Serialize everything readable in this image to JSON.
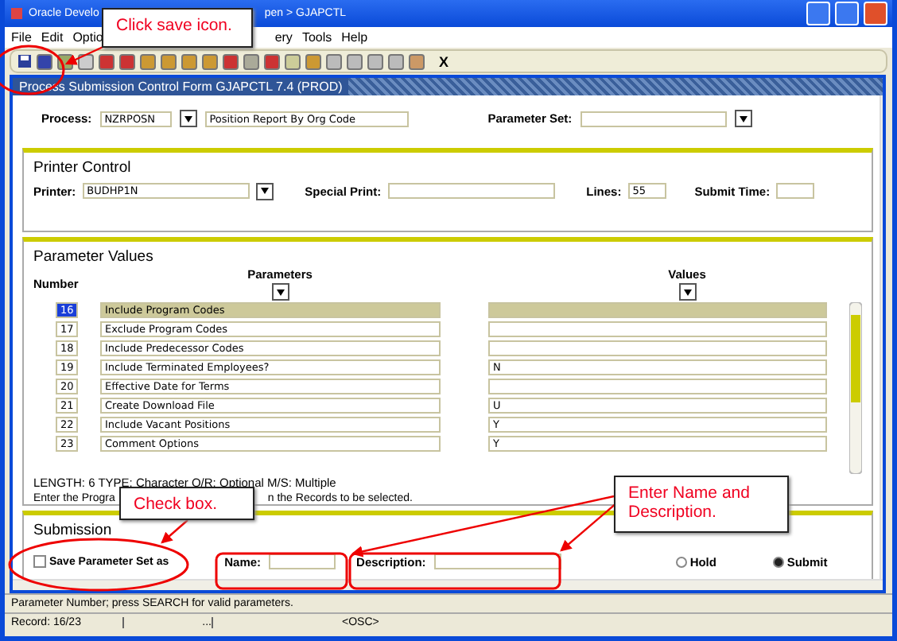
{
  "window": {
    "title_parts": [
      "Oracle Develo",
      "pen > GJAPCTL"
    ]
  },
  "menu": {
    "left": [
      "File",
      "Edit",
      "Optio"
    ],
    "right": [
      "ery",
      "Tools",
      "Help"
    ]
  },
  "toolbar": {
    "exit_label": "X"
  },
  "form": {
    "title": "Process Submission Control Form  GJAPCTL  7.4  (PROD)"
  },
  "process": {
    "label": "Process:",
    "code": "NZRPOSN",
    "description": "Position Report By Org Code",
    "parameter_set_label": "Parameter Set:"
  },
  "printer_control": {
    "heading": "Printer Control",
    "fields": [
      {
        "label": "Printer:",
        "value": "BUDHP1N",
        "kind": "select"
      },
      {
        "label": "Special Print:",
        "kind": "text"
      },
      {
        "label": "Lines:",
        "value": "55",
        "kind": "short"
      },
      {
        "label": "Submit Time:",
        "kind": "short"
      }
    ]
  },
  "parameter_values": {
    "heading": "Parameter Values",
    "columns": {
      "number": "Number",
      "parameters": "Parameters",
      "values": "Values"
    },
    "rows": [
      {
        "number": "16",
        "parameter": "Include Program Codes",
        "selected": true
      },
      {
        "number": "17",
        "parameter": "Exclude Program Codes",
        "selected": false
      },
      {
        "number": "18",
        "parameter": "Include Predecessor Codes",
        "selected": false
      },
      {
        "number": "19",
        "parameter": "Include Terminated Employees?",
        "value": "N",
        "selected": false
      },
      {
        "number": "20",
        "parameter": "Effective Date for Terms",
        "selected": false
      },
      {
        "number": "21",
        "parameter": "Create Download File",
        "value": "U",
        "selected": false
      },
      {
        "number": "22",
        "parameter": "Include Vacant Positions",
        "value": "Y",
        "selected": false
      },
      {
        "number": "23",
        "parameter": "Comment Options",
        "value": "Y",
        "selected": false
      }
    ],
    "info": "LENGTH: 6 TYPE: Character O/R: Optional M/S: Multiple",
    "help_parts": [
      "Enter the Progra",
      "n the Records to be selected."
    ]
  },
  "submission": {
    "heading": "Submission",
    "save_checkbox": {
      "label": "Save Parameter Set as",
      "checked": false
    },
    "name_label": "Name:",
    "description_label": "Description:",
    "radios": [
      {
        "label": "Hold",
        "selected": false
      },
      {
        "label": "Submit",
        "selected": true
      }
    ]
  },
  "status_bar": {
    "message": "Parameter Number; press SEARCH for valid parameters.",
    "record": "Record: 16/23",
    "ellipsis": "...",
    "mode": "<OSC>"
  },
  "callouts": [
    {
      "text": "Click save icon."
    },
    {
      "text": "Check box."
    },
    {
      "text": "Enter Name and Description."
    }
  ]
}
